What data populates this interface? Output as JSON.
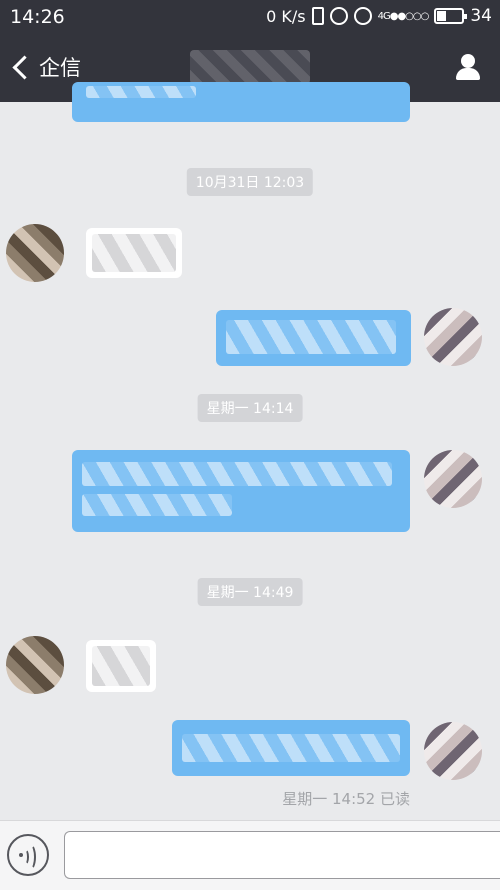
{
  "status_bar": {
    "time": "14:26",
    "net_speed": "0 K/s",
    "network": "4G",
    "battery": "34"
  },
  "nav": {
    "back_label": "企信",
    "back_icon": "chevron-left-icon",
    "contact_icon": "user-icon",
    "title": ""
  },
  "chat": {
    "timestamps": [
      "10月31日 12:03",
      "星期一 14:14",
      "星期一 14:49"
    ],
    "last_sent": "星期一 14:52 已读"
  },
  "input": {
    "voice_icon": "voice-icon",
    "placeholder": ""
  },
  "colors": {
    "header": "#33343c",
    "background": "#e9eaec",
    "outgoing_bubble": "#6fb9f2",
    "incoming_bubble": "#ffffff",
    "timestamp_chip": "#d3d4d7"
  }
}
